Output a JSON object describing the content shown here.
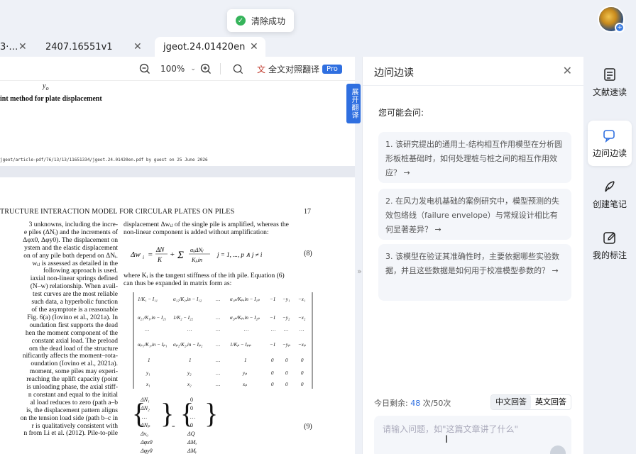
{
  "toast": {
    "icon": "check-circle-icon",
    "text": "清除成功"
  },
  "tabs": [
    {
      "label": "3·…",
      "close": "✕"
    },
    {
      "label": "2407.16551v1",
      "close": "✕"
    },
    {
      "label": "jgeot.24.01420en",
      "close": "✕",
      "active": true
    }
  ],
  "toolbar": {
    "zoom": "100%",
    "translate_label": "全文对照翻译",
    "pro_badge": "Pro"
  },
  "side_button": {
    "label": "展开翻译"
  },
  "document": {
    "page1_title_fragment": "int method for plate displacement",
    "page1_footer": "jgeot/article-pdf/76/13/13/11651334/jgeot.24.01420en.pdf by guest on 25 June 2026",
    "page2_header": "TRUCTURE INTERACTION MODEL FOR CIRCULAR PLATES ON PILES",
    "page2_number": "17",
    "left_col": [
      "3 unknowns, including the incre-",
      "e piles (ΔNᵢ) and the increments of",
      "Δφx0, Δφy0). The displacement on",
      "ystem and the elastic displacement",
      "on of any pile both depend on ΔNᵢ.",
      "wᵢⱼ is assessed as detailed in the",
      "following approach is used.",
      "iaxial non-linear springs defined",
      "(N–w) relationship. When avail-",
      "test curves are the most reliable",
      "such data, a hyperbolic function",
      "of the asymptote is a reasonable",
      "Fig. 6(a) (Iovino et al., 2021a). In",
      "oundation first supports the dead",
      "hen the moment component of the",
      "constant axial load. The preload",
      "om the dead load of the structure",
      "nificantly affects the moment–rota-",
      "oundation (Iovino et al., 2021a).",
      "moment, some piles may experi-",
      "reaching the uplift capacity (point",
      "is unloading phase, the axial stiff-",
      "n constant and equal to the initial",
      "al load reduces to zero (path a–b",
      "is, the displacement pattern aligns",
      "on the tension load side (path b–c in",
      "r is qualitatively consistent with",
      "n from Li et al. (2012). Pile-to-pile"
    ],
    "right_col_top": [
      "displacement Δwᵢⱼ of the single pile is amplified, whereas the",
      "non-linear component is added without amplification:"
    ],
    "eq8_num": "(8)",
    "right_col_mid": [
      "where Kᵢ is the tangent stiffness of the ith pile. Equation (6)",
      "can thus be expanded in matrix form as:"
    ],
    "eq9_num": "(9)"
  },
  "panel": {
    "title": "边问边读",
    "close": "✕",
    "may_ask": "您可能会问:",
    "questions": [
      "1. 该研究提出的通用土-结构相互作用模型在分析圆形板桩基础时，如何处理桩与桩之间的相互作用效应？ →",
      "2. 在风力发电机基础的案例研究中，模型预测的失效包络线（failure envelope）与常规设计相比有何显著差异？ →",
      "3. 该模型在验证其准确性时，主要依据哪些实验数据，并且这些数据是如何用于校准模型参数的？ →"
    ],
    "remain_label": "今日剩余:",
    "remain_count": "48",
    "remain_total": "次/50次",
    "lang_cn": "中文回答",
    "lang_en": "英文回答",
    "input_placeholder": "请输入问题，如\"这篇文章讲了什么\""
  },
  "rail": [
    {
      "label": "文献速读",
      "icon": "document-list-icon"
    },
    {
      "label": "边问边读",
      "icon": "chat-bubble-icon",
      "active": true
    },
    {
      "label": "创建笔记",
      "icon": "feather-pen-icon"
    },
    {
      "label": "我的标注",
      "icon": "edit-note-icon"
    }
  ]
}
